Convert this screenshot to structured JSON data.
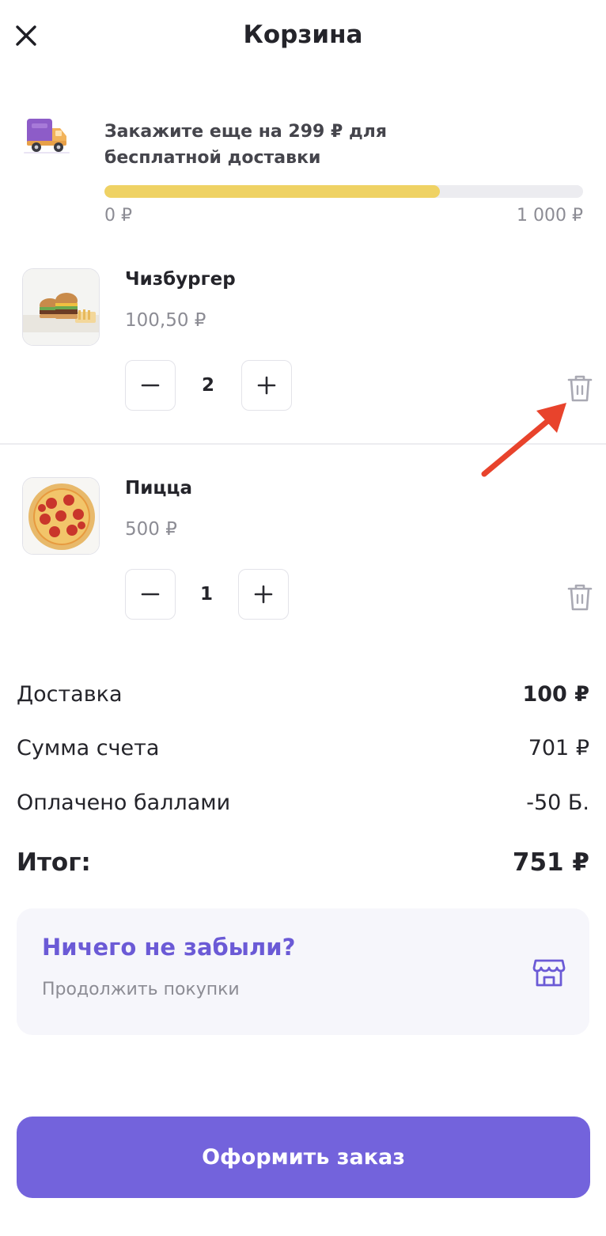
{
  "header": {
    "title": "Корзина",
    "close_icon": "close-icon"
  },
  "delivery": {
    "icon": "truck-icon",
    "message": "Закажите еще на 299 ₽ для бесплатной доставки",
    "progress_fraction": 0.7,
    "progress_color": "#efd264",
    "min_label": "0 ₽",
    "max_label": "1 000 ₽"
  },
  "items": [
    {
      "name": "Чизбургер",
      "price": "100,50 ₽",
      "quantity": "2",
      "image": "cheeseburger-image"
    },
    {
      "name": "Пицца",
      "price": "500 ₽",
      "quantity": "1",
      "image": "pizza-image"
    }
  ],
  "summary": {
    "delivery_label": "Доставка",
    "delivery_value": "100 ₽",
    "subtotal_label": "Сумма счета",
    "subtotal_value": "701 ₽",
    "points_label": "Оплачено баллами",
    "points_value": "-50 Б.",
    "total_label": "Итог:",
    "total_value": "751 ₽"
  },
  "forgot": {
    "title": "Ничего не забыли?",
    "subtitle": "Продолжить покупки",
    "icon": "shop-icon"
  },
  "checkout": {
    "label": "Оформить заказ",
    "color": "#7363dc"
  },
  "colors": {
    "accent": "#7363dc",
    "accent_text": "#6b5ad6",
    "annotation": "#e8432c"
  }
}
